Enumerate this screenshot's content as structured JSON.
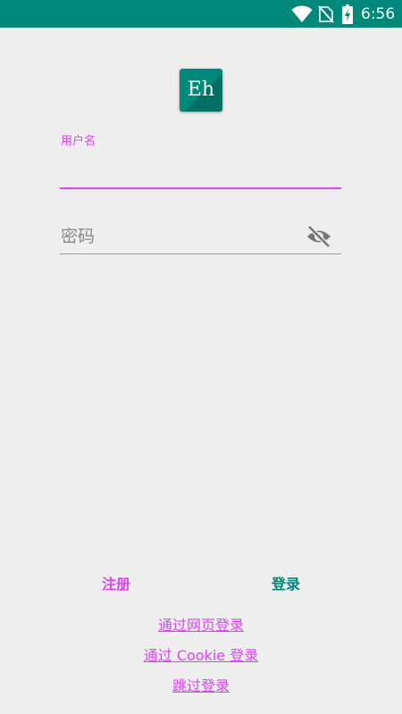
{
  "status_bar": {
    "time": "6:56",
    "battery_level_percent": 60,
    "icons": [
      "wifi-icon",
      "no-sim-icon",
      "battery-charging-icon"
    ]
  },
  "app": {
    "logo_text": "Eh",
    "brand_color": "#00897b",
    "accent_color": "#e040fb"
  },
  "form": {
    "username": {
      "label": "用户名",
      "value": ""
    },
    "password": {
      "placeholder": "密码",
      "value": "",
      "toggle_icon": "visibility-off-icon"
    }
  },
  "actions": {
    "register_label": "注册",
    "sign_in_label": "登录"
  },
  "links": {
    "web_login": "通过网页登录",
    "cookie_login": "通过 Cookie 登录",
    "skip_login": "跳过登录"
  }
}
